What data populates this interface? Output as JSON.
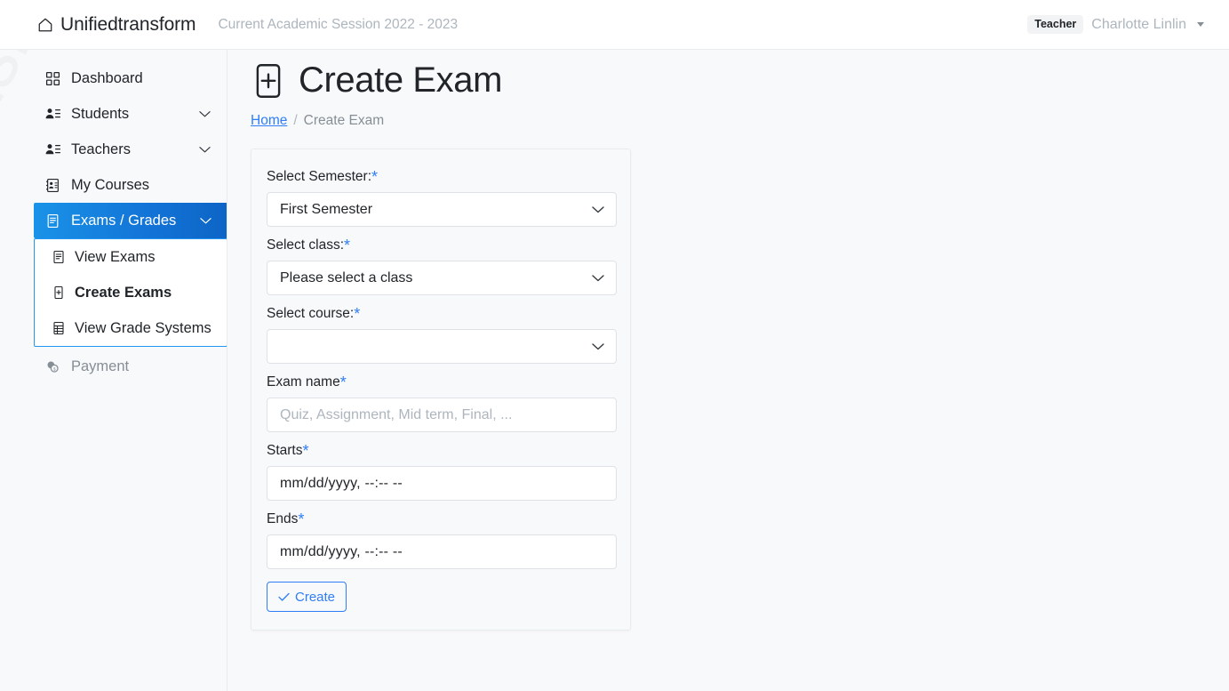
{
  "topnav": {
    "brand": "Unifiedtransform",
    "brand_icon": "home-icon",
    "session": "Current Academic Session 2022 - 2023",
    "role_badge": "Teacher",
    "user_name": "Charlotte Linlin",
    "caret_icon": "caret-down-icon"
  },
  "sidebar": {
    "watermark": "nsform",
    "items": [
      {
        "label": "Dashboard",
        "icon": "grid-icon",
        "expandable": false,
        "active": false,
        "disabled": false
      },
      {
        "label": "Students",
        "icon": "people-list-icon",
        "expandable": true,
        "active": false,
        "disabled": false
      },
      {
        "label": "Teachers",
        "icon": "people-list-icon",
        "expandable": true,
        "active": false,
        "disabled": false
      },
      {
        "label": "My Courses",
        "icon": "contact-card-icon",
        "expandable": false,
        "active": false,
        "disabled": false
      },
      {
        "label": "Exams / Grades",
        "icon": "document-lines-icon",
        "expandable": true,
        "active": true,
        "disabled": false
      }
    ],
    "submenu": [
      {
        "label": "View Exams",
        "icon": "document-lines-icon",
        "current": false
      },
      {
        "label": "Create Exams",
        "icon": "plus-box-icon",
        "current": true
      },
      {
        "label": "View Grade Systems",
        "icon": "table-icon",
        "current": false
      }
    ],
    "payment": {
      "label": "Payment",
      "icon": "coins-icon",
      "disabled": true
    }
  },
  "page": {
    "title": "Create Exam",
    "title_icon": "plus-box-icon",
    "breadcrumb": {
      "home": "Home",
      "separator": "/",
      "current": "Create Exam"
    }
  },
  "form": {
    "semester": {
      "label": "Select Semester:",
      "required_mark": "*",
      "value": "First Semester"
    },
    "class": {
      "label": "Select class:",
      "required_mark": "*",
      "value": "Please select a class"
    },
    "course": {
      "label": "Select course:",
      "required_mark": "*",
      "value": ""
    },
    "exam_name": {
      "label": "Exam name",
      "required_mark": "*",
      "value": "",
      "placeholder": "Quiz, Assignment, Mid term, Final, ..."
    },
    "starts": {
      "label": "Starts",
      "required_mark": "*",
      "value": "mm/dd/yyyy, --:-- --"
    },
    "ends": {
      "label": "Ends",
      "required_mark": "*",
      "value": "mm/dd/yyyy, --:-- --"
    },
    "submit": {
      "label": "Create",
      "icon": "check-icon"
    }
  },
  "colors": {
    "accent_blue": "#2f7ef7",
    "active_gradient_start": "#1a93e8",
    "active_gradient_end": "#0d65c6",
    "page_bg": "#f8f9fa",
    "border": "#e9ecef",
    "muted_text": "#adb5bd"
  }
}
